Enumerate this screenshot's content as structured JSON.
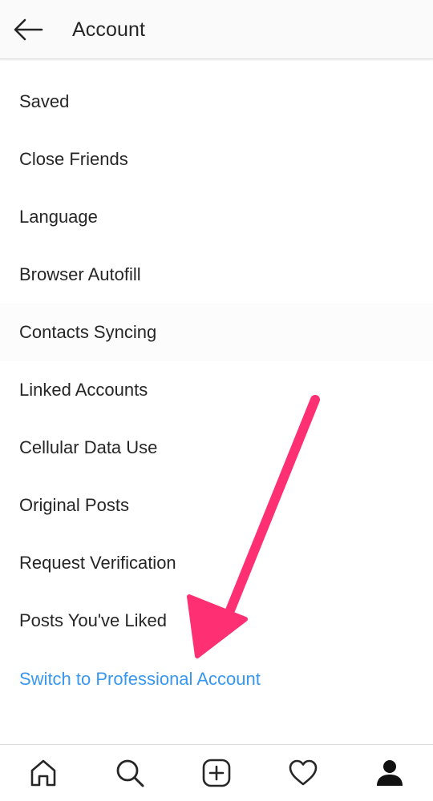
{
  "header": {
    "title": "Account",
    "back_icon": "arrow-left-icon"
  },
  "menu": {
    "items": [
      {
        "label": "Saved"
      },
      {
        "label": "Close Friends"
      },
      {
        "label": "Language"
      },
      {
        "label": "Browser Autofill"
      },
      {
        "label": "Contacts Syncing"
      },
      {
        "label": "Linked Accounts"
      },
      {
        "label": "Cellular Data Use"
      },
      {
        "label": "Original Posts"
      },
      {
        "label": "Request Verification"
      },
      {
        "label": "Posts You've Liked"
      },
      {
        "label": "Switch to Professional Account",
        "color": "#3897f0"
      }
    ]
  },
  "annotation": {
    "arrow_color": "#fe2f72"
  },
  "bottom_nav": {
    "items": [
      {
        "icon": "home-icon"
      },
      {
        "icon": "search-icon"
      },
      {
        "icon": "add-post-icon"
      },
      {
        "icon": "heart-icon"
      },
      {
        "icon": "profile-icon",
        "active": true
      }
    ]
  }
}
